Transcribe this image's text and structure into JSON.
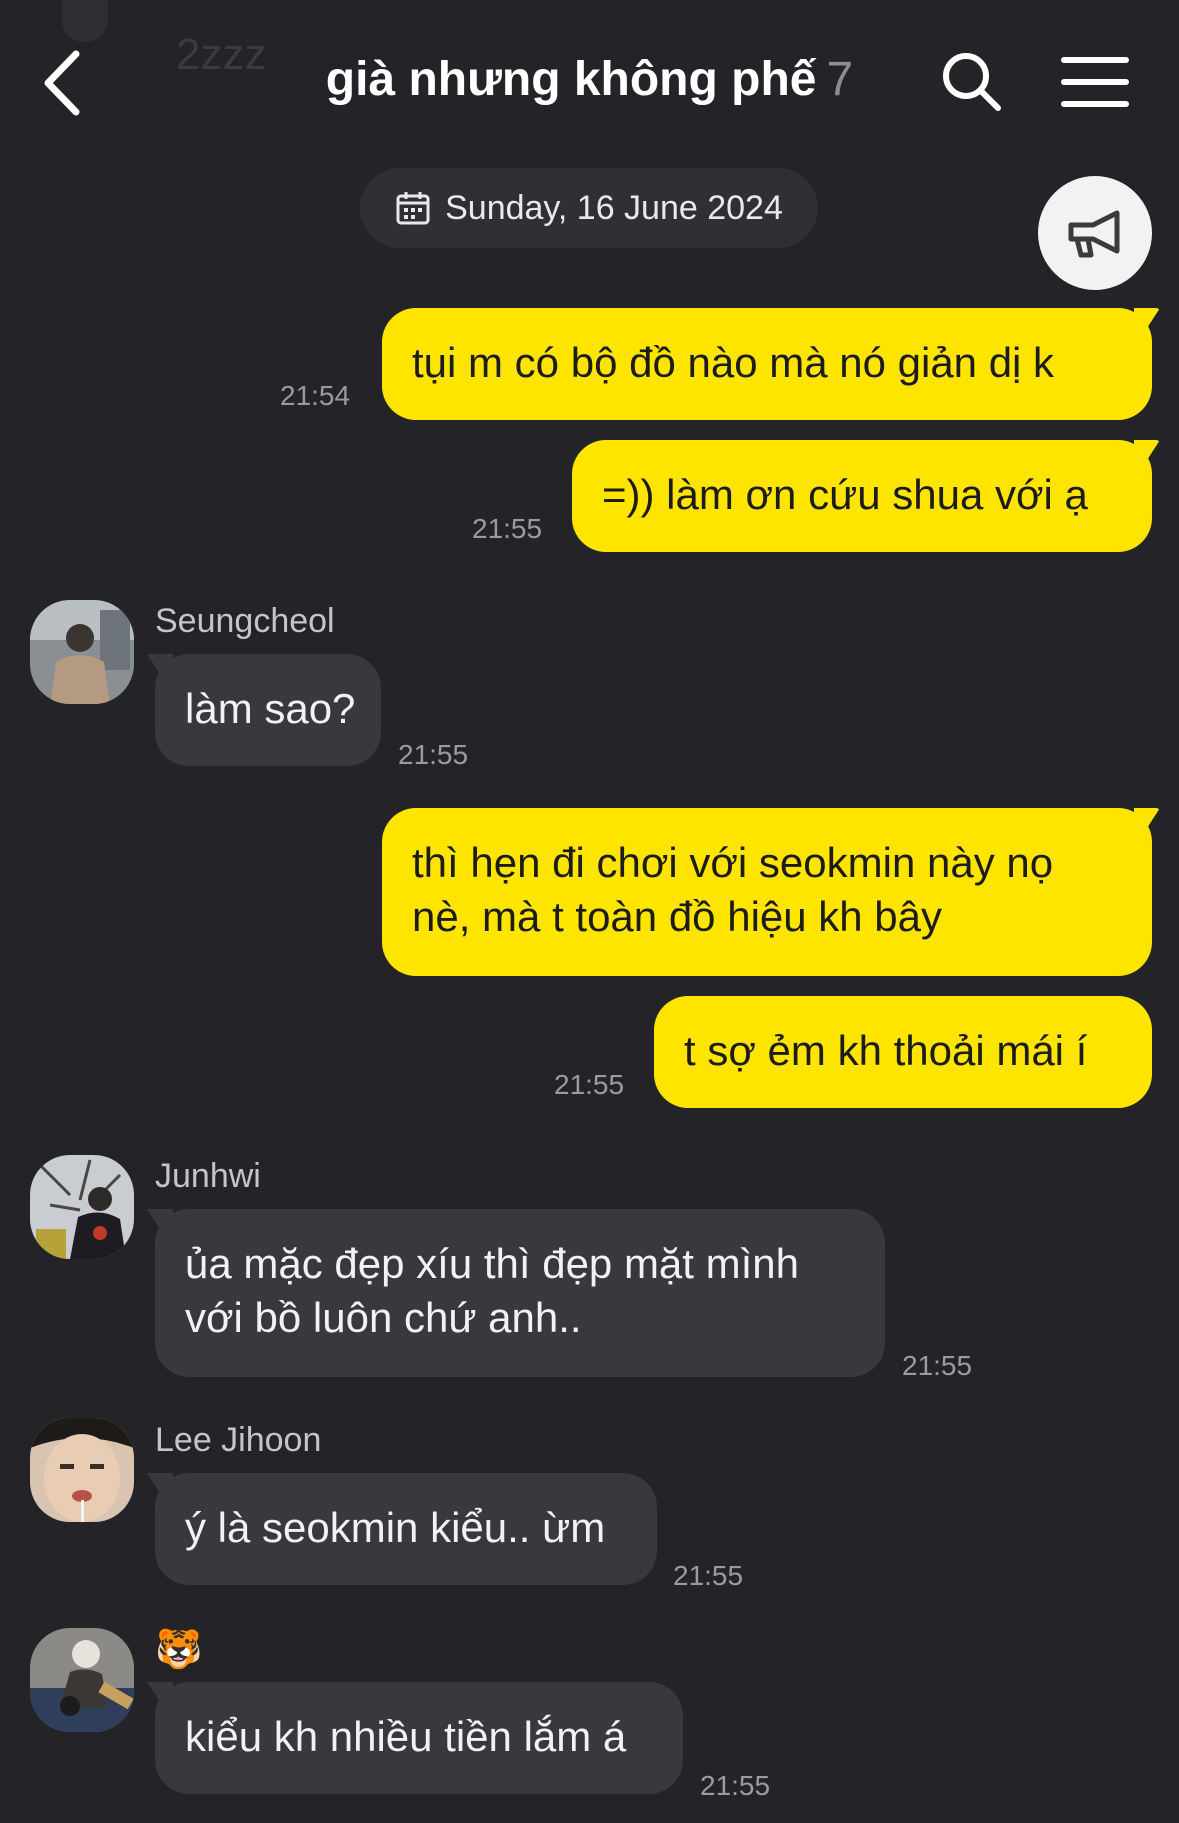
{
  "header": {
    "ghost_text": "2zzz",
    "title": "già nhưng không phế",
    "member_count": "7"
  },
  "date_pill": {
    "label": "Sunday, 16 June 2024"
  },
  "messages": [
    {
      "side": "me",
      "lines": [
        "tụi m có bộ đồ nào mà nó giản dị k"
      ],
      "time": "21:54"
    },
    {
      "side": "me",
      "lines": [
        "=)) làm ơn cứu shua với ạ"
      ],
      "time": "21:55"
    },
    {
      "side": "other",
      "sender": "Seungcheol",
      "lines": [
        "làm sao?"
      ],
      "time": "21:55"
    },
    {
      "side": "me",
      "lines": [
        "thì hẹn đi chơi với seokmin này nọ",
        "nè, mà t toàn đồ hiệu kh bây"
      ],
      "time": ""
    },
    {
      "side": "me",
      "lines": [
        "t sợ ẻm kh thoải mái í"
      ],
      "time": "21:55"
    },
    {
      "side": "other",
      "sender": "Junhwi",
      "lines": [
        "ủa mặc đẹp xíu thì đẹp mặt mình",
        "với bồ luôn chứ anh.."
      ],
      "time": "21:55"
    },
    {
      "side": "other",
      "sender": "Lee Jihoon",
      "lines": [
        "ý là seokmin kiểu.. ừm"
      ],
      "time": "21:55"
    },
    {
      "side": "other",
      "sender": "🐯",
      "lines": [
        "kiểu kh nhiều tiền lắm á"
      ],
      "time": "21:55"
    }
  ],
  "icons": {
    "back": "chevron-left-icon",
    "search": "search-icon",
    "menu": "hamburger-menu-icon",
    "calendar": "calendar-icon",
    "announce": "megaphone-icon"
  },
  "colors": {
    "background": "#242428",
    "my_bubble": "#fde500",
    "other_bubble": "#38383d",
    "time_text": "#9a9aa0"
  }
}
